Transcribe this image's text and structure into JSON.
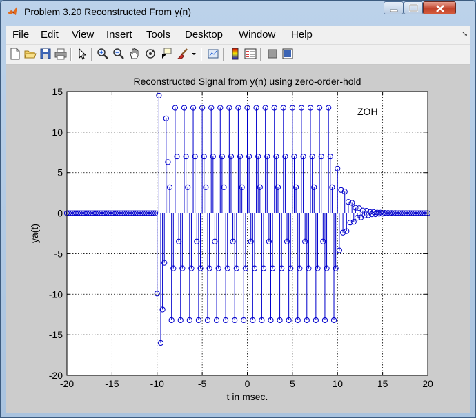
{
  "window": {
    "title": "Problem 3.20 Reconstructed From y(n)",
    "app_icon": "matlab-logo-icon",
    "controls": [
      "minimize-icon",
      "maximize-icon",
      "close-icon"
    ]
  },
  "menubar": {
    "items": [
      "File",
      "Edit",
      "View",
      "Insert",
      "Tools",
      "Desktop",
      "Window",
      "Help"
    ],
    "overflow_glyph": "↘"
  },
  "toolbar": {
    "icons": [
      "new-figure-icon",
      "open-file-icon",
      "save-icon",
      "print-icon",
      "edit-plot-arrow-icon",
      "zoom-in-icon",
      "zoom-out-icon",
      "pan-hand-icon",
      "rotate-3d-icon",
      "data-cursor-icon",
      "brush-icon",
      "brush-dropdown-icon",
      "link-plot-icon",
      "colorbar-icon",
      "legend-icon",
      "hide-plot-tools-icon",
      "show-plot-tools-icon"
    ]
  },
  "colors": {
    "stem": "#0000cc",
    "axes_bg": "#ffffff",
    "figure_bg": "#cccccc",
    "grid": "#000000"
  },
  "chart_data": {
    "type": "stem",
    "title": "Reconstructed Signal from y(n) using zero-order-hold",
    "xlabel": "t in msec.",
    "ylabel": "ya(t)",
    "xlim": [
      -20,
      20
    ],
    "ylim": [
      -20,
      15
    ],
    "xticks": [
      -20,
      -15,
      -10,
      -5,
      0,
      5,
      10,
      15,
      20
    ],
    "yticks": [
      15,
      10,
      5,
      0,
      -5,
      -10,
      -15,
      -20
    ],
    "grid": true,
    "grid_style": "dotted",
    "marker": "circle",
    "annotation": "ZOH",
    "annotation_position": "top-right",
    "series": [
      {
        "sample_spacing": 0.2,
        "segments": [
          {
            "range": [
              -20,
              -10
            ],
            "shape": "zero"
          },
          {
            "range": [
              -10,
              10
            ],
            "shape": "oscillating",
            "high_envelope": [
              13,
              7,
              3.2
            ],
            "low_envelope": [
              -13.2,
              -6.8,
              -3.5
            ],
            "extremes": [
              -16,
              14.5
            ]
          },
          {
            "range": [
              10,
              20
            ],
            "shape": "exponential-decay",
            "start_amplitude": 5.5
          }
        ]
      }
    ]
  }
}
